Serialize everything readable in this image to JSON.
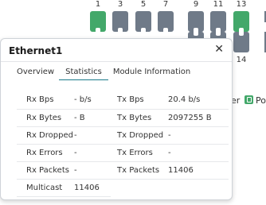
{
  "ports": {
    "top_numbers": [
      "1",
      "3",
      "5",
      "7",
      "9",
      "11",
      "13"
    ],
    "bottom_numbers": [
      "14"
    ],
    "active_color": "#43a86a",
    "inactive_color": "#6f7a88"
  },
  "legend": {
    "partial_label": "er",
    "poe_label": "Po"
  },
  "popup": {
    "title": "Ethernet1",
    "tabs": [
      "Overview",
      "Statistics",
      "Module Information"
    ],
    "selected_tab": "Statistics",
    "rows": [
      {
        "label": "Rx Bps",
        "value": "- b/s",
        "label2": "Tx Bps",
        "value2": "20.4 b/s"
      },
      {
        "label": "Rx Bytes",
        "value": "- B",
        "label2": "Tx Bytes",
        "value2": "2097255 B"
      },
      {
        "label": "Rx Dropped",
        "value": "-",
        "label2": "Tx Dropped",
        "value2": "-"
      },
      {
        "label": "Rx Errors",
        "value": "-",
        "label2": "Tx Errors",
        "value2": "-"
      },
      {
        "label": "Rx Packets",
        "value": "-",
        "label2": "Tx Packets",
        "value2": "11406"
      },
      {
        "label": "Multicast",
        "value": "11406",
        "label2": "",
        "value2": ""
      }
    ]
  }
}
